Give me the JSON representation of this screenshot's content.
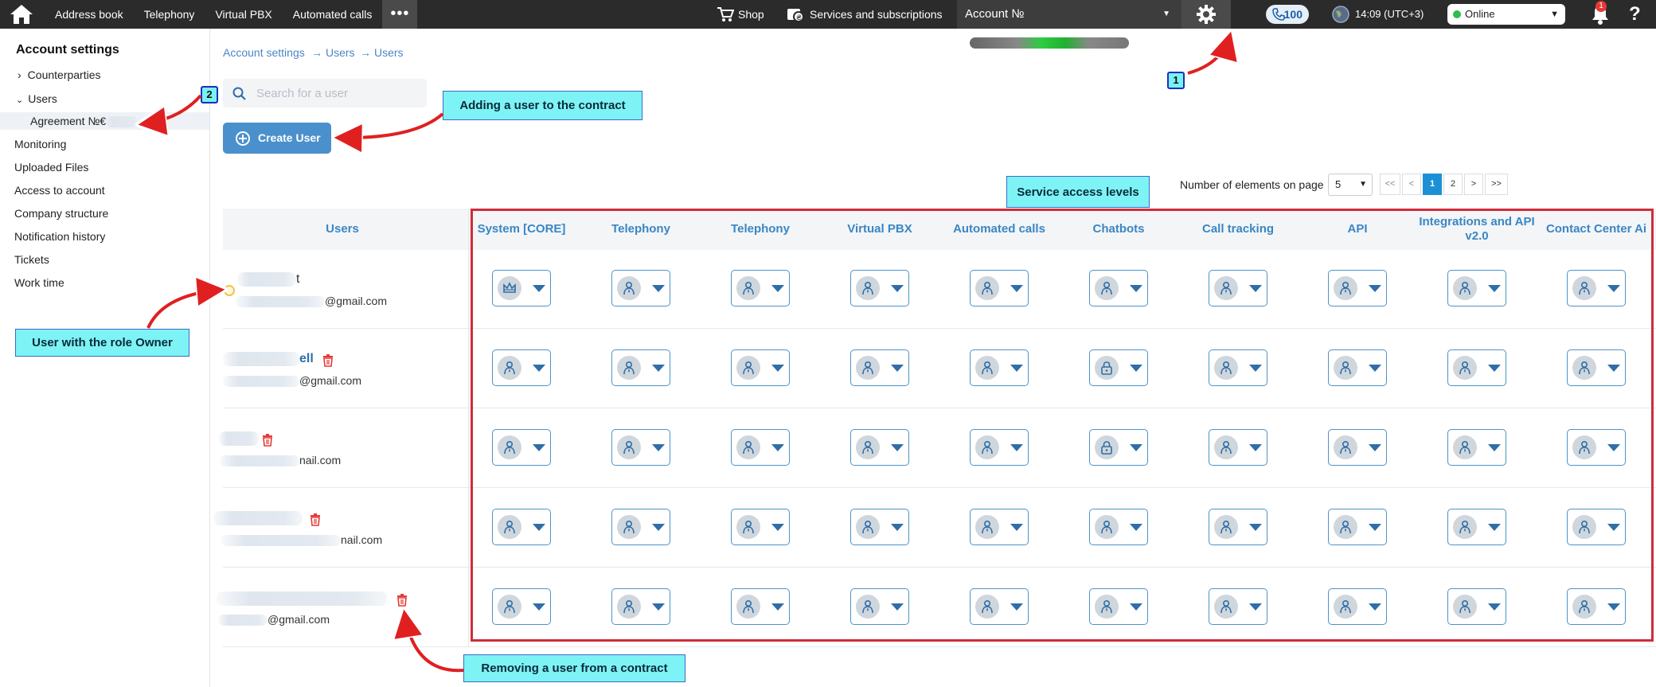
{
  "topbar": {
    "nav": [
      "Address book",
      "Telephony",
      "Virtual PBX",
      "Automated calls"
    ],
    "more": "•••",
    "shop": "Shop",
    "services": "Services and subscriptions",
    "account_label": "Account №",
    "balance": "100",
    "time": "14:09 (UTC+3)",
    "status": "Online",
    "notifications": "1",
    "help": "?"
  },
  "sidebar": {
    "title": "Account settings",
    "items": {
      "counterparties": "Counterparties",
      "users": "Users",
      "agreement": "Agreement №€",
      "monitoring": "Monitoring",
      "uploaded": "Uploaded Files",
      "access": "Access to account",
      "company": "Company structure",
      "notifications": "Notification history",
      "tickets": "Tickets",
      "worktime": "Work time"
    }
  },
  "breadcrumb": [
    "Account settings",
    "→",
    "Users",
    "→",
    "Users"
  ],
  "search": {
    "placeholder": "Search for a user"
  },
  "create_button": "Create User",
  "pagination": {
    "label": "Number of elements on page",
    "page_size": "5",
    "buttons": [
      "<<",
      "<",
      "1",
      "2",
      ">",
      ">>"
    ],
    "current": "1"
  },
  "table": {
    "users_header": "Users",
    "columns": [
      "System [CORE]",
      "Telephony",
      "Telephony",
      "Virtual PBX",
      "Automated calls",
      "Chatbots",
      "Call tracking",
      "API",
      "Integrations and API v2.0",
      "Contact Center Ai"
    ],
    "rows": [
      {
        "name_suffix": "t",
        "email": "@gmail.com",
        "owner": true,
        "access": [
          "owner",
          "user",
          "user",
          "user",
          "user",
          "user",
          "user",
          "user",
          "user",
          "user"
        ]
      },
      {
        "name_suffix": "ell",
        "email": "@gmail.com",
        "owner": false,
        "access": [
          "user",
          "user",
          "user",
          "user",
          "user",
          "locked",
          "user",
          "user",
          "user",
          "user"
        ]
      },
      {
        "name_suffix": "",
        "email": "nail.com",
        "owner": false,
        "access": [
          "user",
          "user",
          "user",
          "user",
          "user",
          "locked",
          "user",
          "user",
          "user",
          "user"
        ]
      },
      {
        "name_suffix": "",
        "email": "nail.com",
        "owner": false,
        "access": [
          "user",
          "user",
          "user",
          "user",
          "user",
          "user",
          "user",
          "user",
          "user",
          "user"
        ]
      },
      {
        "name_suffix": "",
        "email": "@gmail.com",
        "owner": false,
        "access": [
          "user",
          "user",
          "user",
          "user",
          "user",
          "user",
          "user",
          "user",
          "user",
          "user"
        ]
      }
    ]
  },
  "annotations": {
    "adding": "Adding a user to the contract",
    "levels": "Service access levels",
    "owner": "User with the role Owner",
    "removing": "Removing a user from a contract",
    "tag1": "1",
    "tag2": "2"
  },
  "colors": {
    "accent": "#4a90cc",
    "header_text": "#3a86c4",
    "annotation_bg": "#7ef3f5",
    "frame": "#cf2c3c"
  }
}
